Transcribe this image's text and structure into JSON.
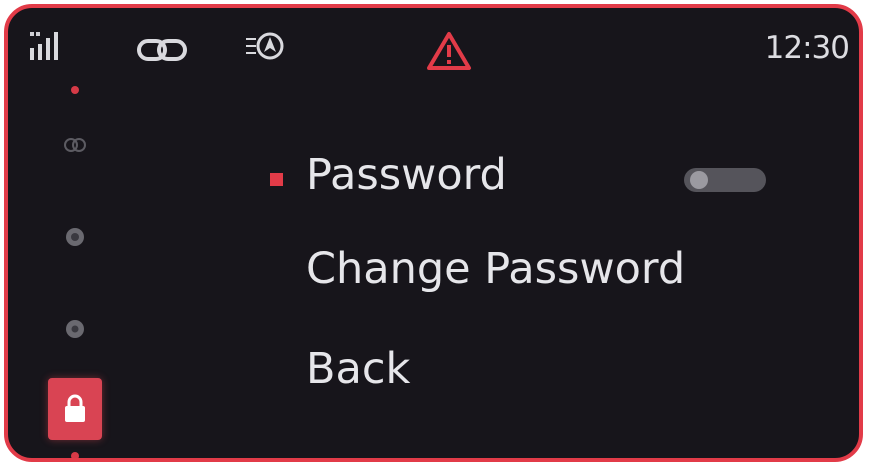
{
  "status_bar": {
    "time": "12:30",
    "icons": [
      "signal-icon",
      "link-icon",
      "navigation-icon",
      "warning-icon"
    ],
    "warning_color": "#e23b48"
  },
  "sidebar": {
    "items": [
      {
        "icon": "media-icon",
        "active": false
      },
      {
        "icon": "phone-icon",
        "active": false
      },
      {
        "icon": "settings-icon",
        "active": false
      },
      {
        "icon": "lock-icon",
        "active": true
      }
    ],
    "accent_color": "#d94453"
  },
  "menu": {
    "items": [
      {
        "label": "Password",
        "selected": true,
        "toggle": true,
        "toggle_on": false
      },
      {
        "label": "Change Password",
        "selected": false
      },
      {
        "label": "Back",
        "selected": false
      }
    ]
  },
  "colors": {
    "frame": "#e23b48",
    "background": "#17151b",
    "text": "#e6e6ea"
  }
}
